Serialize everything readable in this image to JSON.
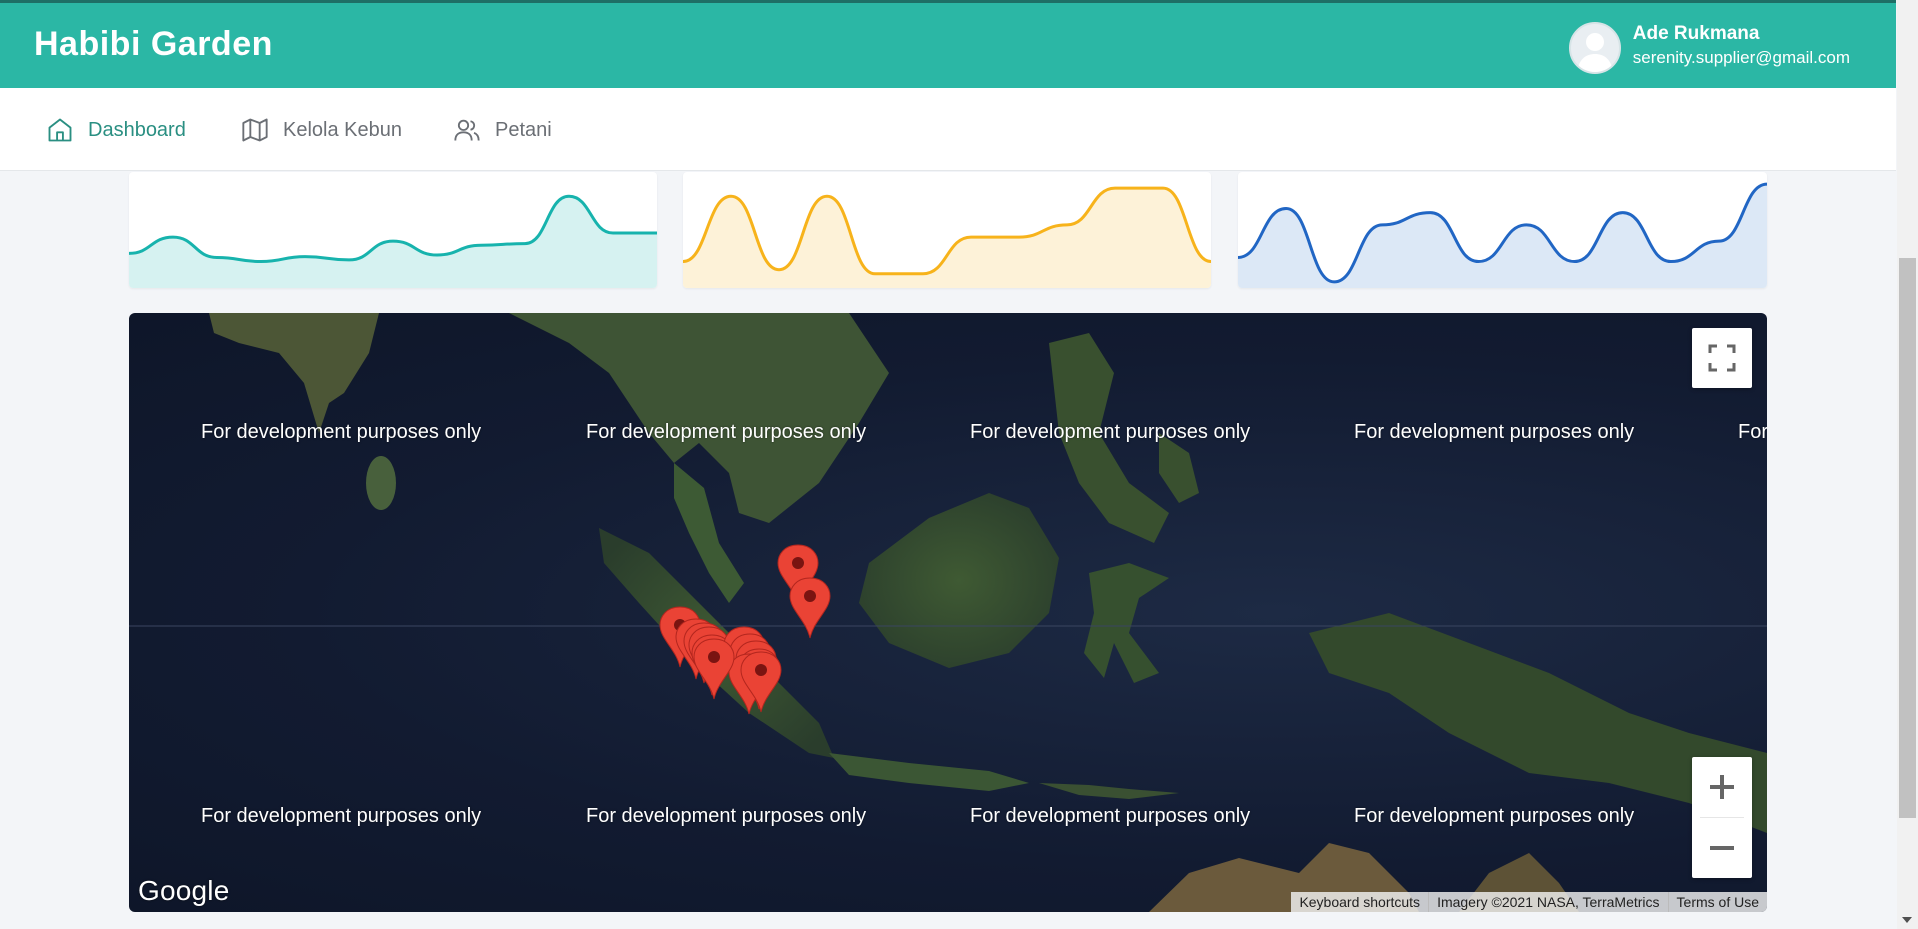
{
  "header": {
    "brand": "Habibi Garden",
    "user": {
      "name": "Ade Rukmana",
      "email": "serenity.supplier@gmail.com"
    }
  },
  "nav": {
    "items": [
      {
        "label": "Dashboard",
        "icon": "home-icon",
        "active": true
      },
      {
        "label": "Kelola Kebun",
        "icon": "map-icon",
        "active": false
      },
      {
        "label": "Petani",
        "icon": "users-icon",
        "active": false
      }
    ]
  },
  "sparklines": [
    {
      "color": "#17b3ad",
      "fill": "#d6f2f1",
      "values": [
        4,
        6,
        3.5,
        3,
        3.6,
        3.2,
        5.5,
        3.8,
        5,
        5.2,
        11,
        6.5,
        6.5
      ]
    },
    {
      "color": "#f7b31b",
      "fill": "#fdf2d8",
      "values": [
        3,
        11,
        2,
        11,
        1.5,
        1.5,
        6,
        6,
        7.5,
        12,
        12,
        3
      ]
    },
    {
      "color": "#2166c4",
      "fill": "#dce8f6",
      "values": [
        3.5,
        9.5,
        0.5,
        7.5,
        9,
        3,
        7.5,
        3,
        9,
        3,
        5.5,
        12.5
      ]
    }
  ],
  "map": {
    "watermark": "For development purposes only",
    "watermark_clipped": "For",
    "google_label": "Google",
    "attribution": [
      "Keyboard shortcuts",
      "Imagery ©2021 NASA, TerraMetrics",
      "Terms of Use"
    ],
    "fullscreen_icon": "fullscreen-icon",
    "zoom_in_icon": "plus-icon",
    "zoom_out_icon": "minus-icon",
    "marker_count": 14
  }
}
